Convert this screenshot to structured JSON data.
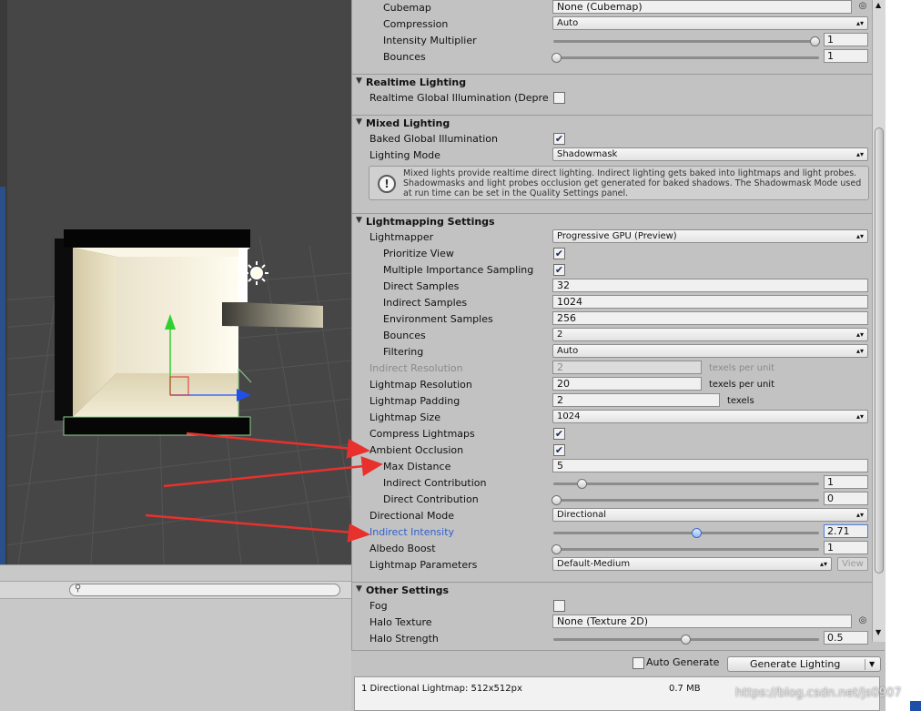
{
  "environment": {
    "cubemap": {
      "label": "Cubemap",
      "value": "None (Cubemap)"
    },
    "compression": {
      "label": "Compression",
      "value": "Auto"
    },
    "intensity_multiplier": {
      "label": "Intensity Multiplier",
      "value": "1"
    },
    "bounces": {
      "label": "Bounces",
      "value": "1"
    }
  },
  "realtime_lighting": {
    "title": "Realtime Lighting",
    "realtime_gi": {
      "label": "Realtime Global Illumination (Depre",
      "checked": false
    }
  },
  "mixed_lighting": {
    "title": "Mixed Lighting",
    "baked_gi": {
      "label": "Baked Global Illumination",
      "checked": true
    },
    "lighting_mode": {
      "label": "Lighting Mode",
      "value": "Shadowmask"
    },
    "help": "Mixed lights provide realtime direct lighting. Indirect lighting gets baked into lightmaps and light probes. Shadowmasks and light probes occlusion get generated for baked shadows. The Shadowmask Mode used at run time can be set in the Quality Settings panel."
  },
  "lightmapping": {
    "title": "Lightmapping Settings",
    "lightmapper": {
      "label": "Lightmapper",
      "value": "Progressive GPU (Preview)"
    },
    "prioritize_view": {
      "label": "Prioritize View",
      "checked": true
    },
    "mis": {
      "label": "Multiple Importance Sampling",
      "checked": true
    },
    "direct_samples": {
      "label": "Direct Samples",
      "value": "32"
    },
    "indirect_samples": {
      "label": "Indirect Samples",
      "value": "1024"
    },
    "environment_samples": {
      "label": "Environment Samples",
      "value": "256"
    },
    "bounces": {
      "label": "Bounces",
      "value": "2"
    },
    "filtering": {
      "label": "Filtering",
      "value": "Auto"
    },
    "indirect_resolution": {
      "label": "Indirect Resolution",
      "value": "2",
      "suffix": "texels per unit"
    },
    "lightmap_resolution": {
      "label": "Lightmap Resolution",
      "value": "20",
      "suffix": "texels per unit"
    },
    "lightmap_padding": {
      "label": "Lightmap Padding",
      "value": "2",
      "suffix": "texels"
    },
    "lightmap_size": {
      "label": "Lightmap Size",
      "value": "1024"
    },
    "compress_lightmaps": {
      "label": "Compress Lightmaps",
      "checked": true
    },
    "ambient_occlusion": {
      "label": "Ambient Occlusion",
      "checked": true
    },
    "max_distance": {
      "label": "Max Distance",
      "value": "5"
    },
    "indirect_contribution": {
      "label": "Indirect Contribution",
      "value": "1",
      "level": 0.1
    },
    "direct_contribution": {
      "label": "Direct Contribution",
      "value": "0",
      "level": 0.0
    },
    "directional_mode": {
      "label": "Directional Mode",
      "value": "Directional"
    },
    "indirect_intensity": {
      "label": "Indirect Intensity",
      "value": "2.71",
      "level": 0.54
    },
    "albedo_boost": {
      "label": "Albedo Boost",
      "value": "1",
      "level": 0.0
    },
    "lightmap_parameters": {
      "label": "Lightmap Parameters",
      "value": "Default-Medium",
      "view_label": "View"
    }
  },
  "other_settings": {
    "title": "Other Settings",
    "fog": {
      "label": "Fog",
      "checked": false
    },
    "halo_texture": {
      "label": "Halo Texture",
      "value": "None (Texture 2D)"
    },
    "halo_strength": {
      "label": "Halo Strength",
      "value": "0.5",
      "level": 0.5
    }
  },
  "sliders": {
    "intensity_multiplier_level": 1.0,
    "bounces_level": 0.0
  },
  "generate": {
    "auto_label": "Auto Generate",
    "auto_checked": false,
    "button_label": "Generate Lighting"
  },
  "stats": {
    "lightmap_info": "1 Directional Lightmap: 512x512px",
    "size": "0.7 MB"
  },
  "watermark": "https://blog.csdn.net/js0907",
  "colors": {
    "highlight_label": "#2f5fd0",
    "annotation_arrow": "#e8312c",
    "scene_bg": "#464646"
  }
}
